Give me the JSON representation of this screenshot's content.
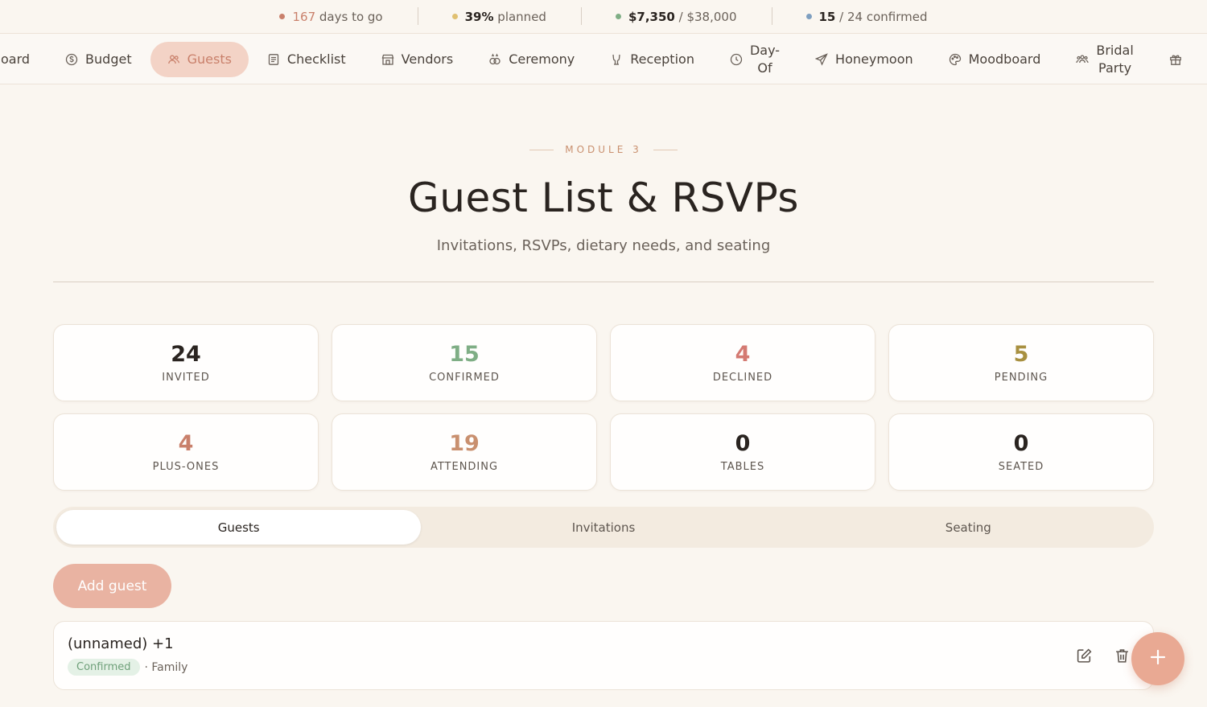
{
  "topbar": {
    "days": {
      "value": "167",
      "label": "days to go",
      "color": "#c9806b"
    },
    "planned": {
      "value": "39%",
      "label": "planned",
      "color": "#e0c070"
    },
    "budget": {
      "spent": "$7,350",
      "separator": "/",
      "total": "$38,000",
      "color": "#7fae85"
    },
    "confirmed": {
      "value": "15",
      "separator": "/",
      "rest": "24 confirmed",
      "color": "#7e9fc0"
    }
  },
  "nav": {
    "items": [
      {
        "label": "Dashboard",
        "visible_label": "oard",
        "icon": "home-icon"
      },
      {
        "label": "Budget",
        "icon": "dollar-icon"
      },
      {
        "label": "Guests",
        "icon": "users-icon",
        "active": true
      },
      {
        "label": "Checklist",
        "icon": "checklist-icon"
      },
      {
        "label": "Vendors",
        "icon": "store-icon"
      },
      {
        "label": "Ceremony",
        "icon": "rings-icon"
      },
      {
        "label": "Reception",
        "icon": "glasses-icon"
      },
      {
        "label_line1": "Day-",
        "label_line2": "Of",
        "icon": "clock-icon"
      },
      {
        "label": "Honeymoon",
        "icon": "plane-icon"
      },
      {
        "label": "Moodboard",
        "icon": "palette-icon"
      },
      {
        "label_line1": "Bridal",
        "label_line2": "Party",
        "icon": "group-icon"
      },
      {
        "label": "",
        "icon": "gift-icon"
      }
    ]
  },
  "header": {
    "eyebrow": "MODULE 3",
    "title": "Guest List & RSVPs",
    "subtitle": "Invitations, RSVPs, dietary needs, and seating"
  },
  "stats": [
    {
      "value": "24",
      "label": "INVITED",
      "color": "#2a2420"
    },
    {
      "value": "15",
      "label": "CONFIRMED",
      "color": "#7fae85"
    },
    {
      "value": "4",
      "label": "DECLINED",
      "color": "#d47a72"
    },
    {
      "value": "5",
      "label": "PENDING",
      "color": "#a89040"
    },
    {
      "value": "4",
      "label": "PLUS-ONES",
      "color": "#c9806b"
    },
    {
      "value": "19",
      "label": "ATTENDING",
      "color": "#c9906f"
    },
    {
      "value": "0",
      "label": "TABLES",
      "color": "#2a2420"
    },
    {
      "value": "0",
      "label": "SEATED",
      "color": "#2a2420"
    }
  ],
  "tabs": [
    {
      "label": "Guests",
      "active": true
    },
    {
      "label": "Invitations"
    },
    {
      "label": "Seating"
    }
  ],
  "add_button": "Add guest",
  "guests": [
    {
      "name": "(unnamed) +1",
      "status": "Confirmed",
      "group": "· Family"
    }
  ]
}
